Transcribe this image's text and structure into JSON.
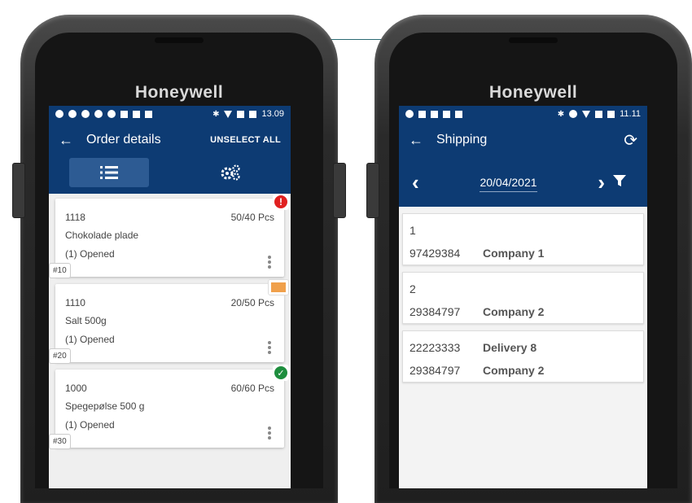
{
  "left_device": {
    "brand": "Honeywell",
    "status_time": "13.09",
    "appbar": {
      "back_icon": "arrow-left-icon",
      "title": "Order details",
      "action": "UNSELECT ALL"
    },
    "toolbar": {
      "list_icon": "list-icon",
      "settings_icon": "gears-icon"
    },
    "orders": [
      {
        "number": "1118",
        "qty": "50/40 Pcs",
        "name": "Chokolade plade",
        "state": "(1) Opened",
        "tag": "#10",
        "badge": "error",
        "badge_icon": "exclamation-icon"
      },
      {
        "number": "1110",
        "qty": "20/50 Pcs",
        "name": "Salt 500g",
        "state": "(1) Opened",
        "tag": "#20",
        "badge": "box",
        "badge_icon": "package-icon"
      },
      {
        "number": "1000",
        "qty": "60/60 Pcs",
        "name": "Spegepølse 500 g",
        "state": "(1) Opened",
        "tag": "#30",
        "badge": "ok",
        "badge_icon": "check-icon"
      }
    ]
  },
  "right_device": {
    "brand": "Honeywell",
    "status_time": "11.11",
    "appbar": {
      "back_icon": "arrow-left-icon",
      "title": "Shipping",
      "sync_icon": "sync-icon"
    },
    "datebar": {
      "prev_icon": "chevron-left-icon",
      "date": "20/04/2021",
      "next_icon": "chevron-right-icon",
      "filter_icon": "filter-icon"
    },
    "shipments": [
      {
        "top_left": "1",
        "top_right": "",
        "bottom_left": "97429384",
        "bottom_right": "Company 1"
      },
      {
        "top_left": "2",
        "top_right": "",
        "bottom_left": "29384797",
        "bottom_right": "Company 2"
      },
      {
        "top_left": "22223333",
        "top_right": "Delivery 8",
        "bottom_left": "29384797",
        "bottom_right": "Company 2"
      }
    ]
  },
  "colors": {
    "header": "#0d3b73",
    "error": "#e02020",
    "ok": "#1e8e3e",
    "box": "#f0a04b"
  }
}
